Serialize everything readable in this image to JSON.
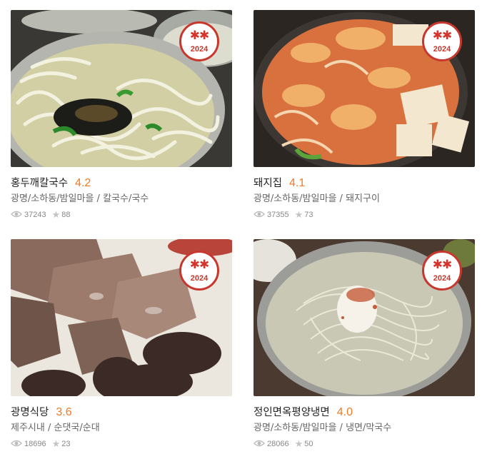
{
  "badge": {
    "stars": "✱✱",
    "year": "2024",
    "color": "#c8372d"
  },
  "accent_score_color": "#f07a26",
  "restaurants": [
    {
      "name": "홍두깨칼국수",
      "score": "4.2",
      "region": "광명/소하동/밤일마을",
      "cuisine": "칼국수/국수",
      "views": "37243",
      "likes": "88"
    },
    {
      "name": "돼지집",
      "score": "4.1",
      "region": "광명/소하동/밤일마을",
      "cuisine": "돼지구이",
      "views": "37355",
      "likes": "73"
    },
    {
      "name": "광명식당",
      "score": "3.6",
      "region": "제주시내",
      "cuisine": "순댓국/순대",
      "views": "18696",
      "likes": "23"
    },
    {
      "name": "정인면옥평양냉면",
      "score": "4.0",
      "region": "광명/소하동/밤일마을",
      "cuisine": "냉면/막국수",
      "views": "28066",
      "likes": "50"
    }
  ],
  "separator": " / ",
  "icons": {
    "views": "eye-icon",
    "likes": "star-icon"
  }
}
